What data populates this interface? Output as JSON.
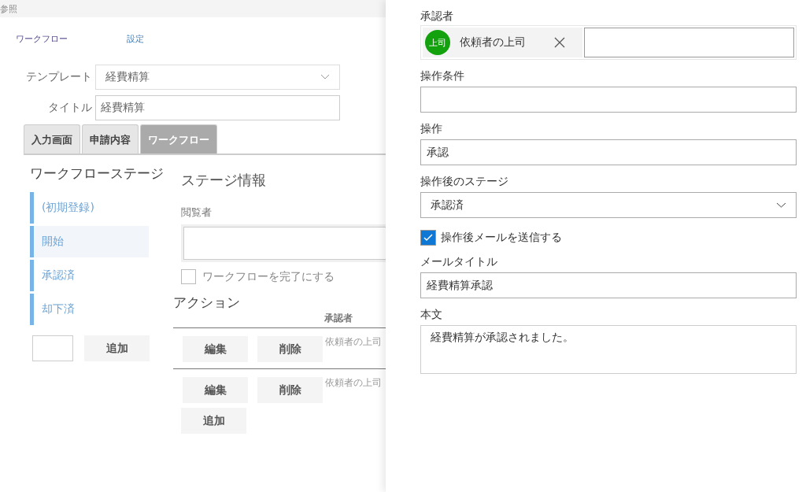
{
  "header": {
    "title": "参照"
  },
  "nav": [
    {
      "label": "ワークフロー",
      "kind": "plain"
    },
    {
      "label": "設定",
      "kind": "link"
    }
  ],
  "form": {
    "template": {
      "label": "テンプレート",
      "value": "経費精算"
    },
    "title": {
      "label": "タイトル",
      "value": "経費精算"
    }
  },
  "tabs": [
    {
      "label": "入力画面",
      "selected": false
    },
    {
      "label": "申請内容",
      "selected": false
    },
    {
      "label": "ワークフロー",
      "selected": true
    }
  ],
  "stages": {
    "heading": "ワークフローステージ",
    "items": [
      {
        "label": "(初期登録)",
        "selected": false
      },
      {
        "label": "開始",
        "selected": true
      },
      {
        "label": "承認済",
        "selected": false
      },
      {
        "label": "却下済",
        "selected": false
      }
    ],
    "add_button": "追加"
  },
  "stage_info": {
    "heading": "ステージ情報",
    "viewer_label": "閲覧者",
    "complete_checkbox": {
      "label": "ワークフローを完了にする",
      "checked": false
    }
  },
  "actions": {
    "heading": "アクション",
    "columns": [
      "承認者"
    ],
    "rows": [
      {
        "edit": "編集",
        "delete": "削除",
        "approver": "依頼者の上司"
      },
      {
        "edit": "編集",
        "delete": "削除",
        "approver": "依頼者の上司"
      }
    ],
    "add_button": "追加"
  },
  "panel": {
    "approver_label": "承認者",
    "approver": {
      "initials": "上司",
      "name": "依頼者の上司",
      "color": "#13a10e"
    },
    "condition_label": "操作条件",
    "operation_label": "操作",
    "operation_value": "承認",
    "next_stage_label": "操作後のステージ",
    "next_stage_value": "承認済",
    "send_mail": {
      "label": "操作後メールを送信する",
      "checked": true
    },
    "mail_title_label": "メールタイトル",
    "mail_title_value": "経費精算承認",
    "body_label": "本文",
    "body_value": "経費精算が承認されました。"
  }
}
